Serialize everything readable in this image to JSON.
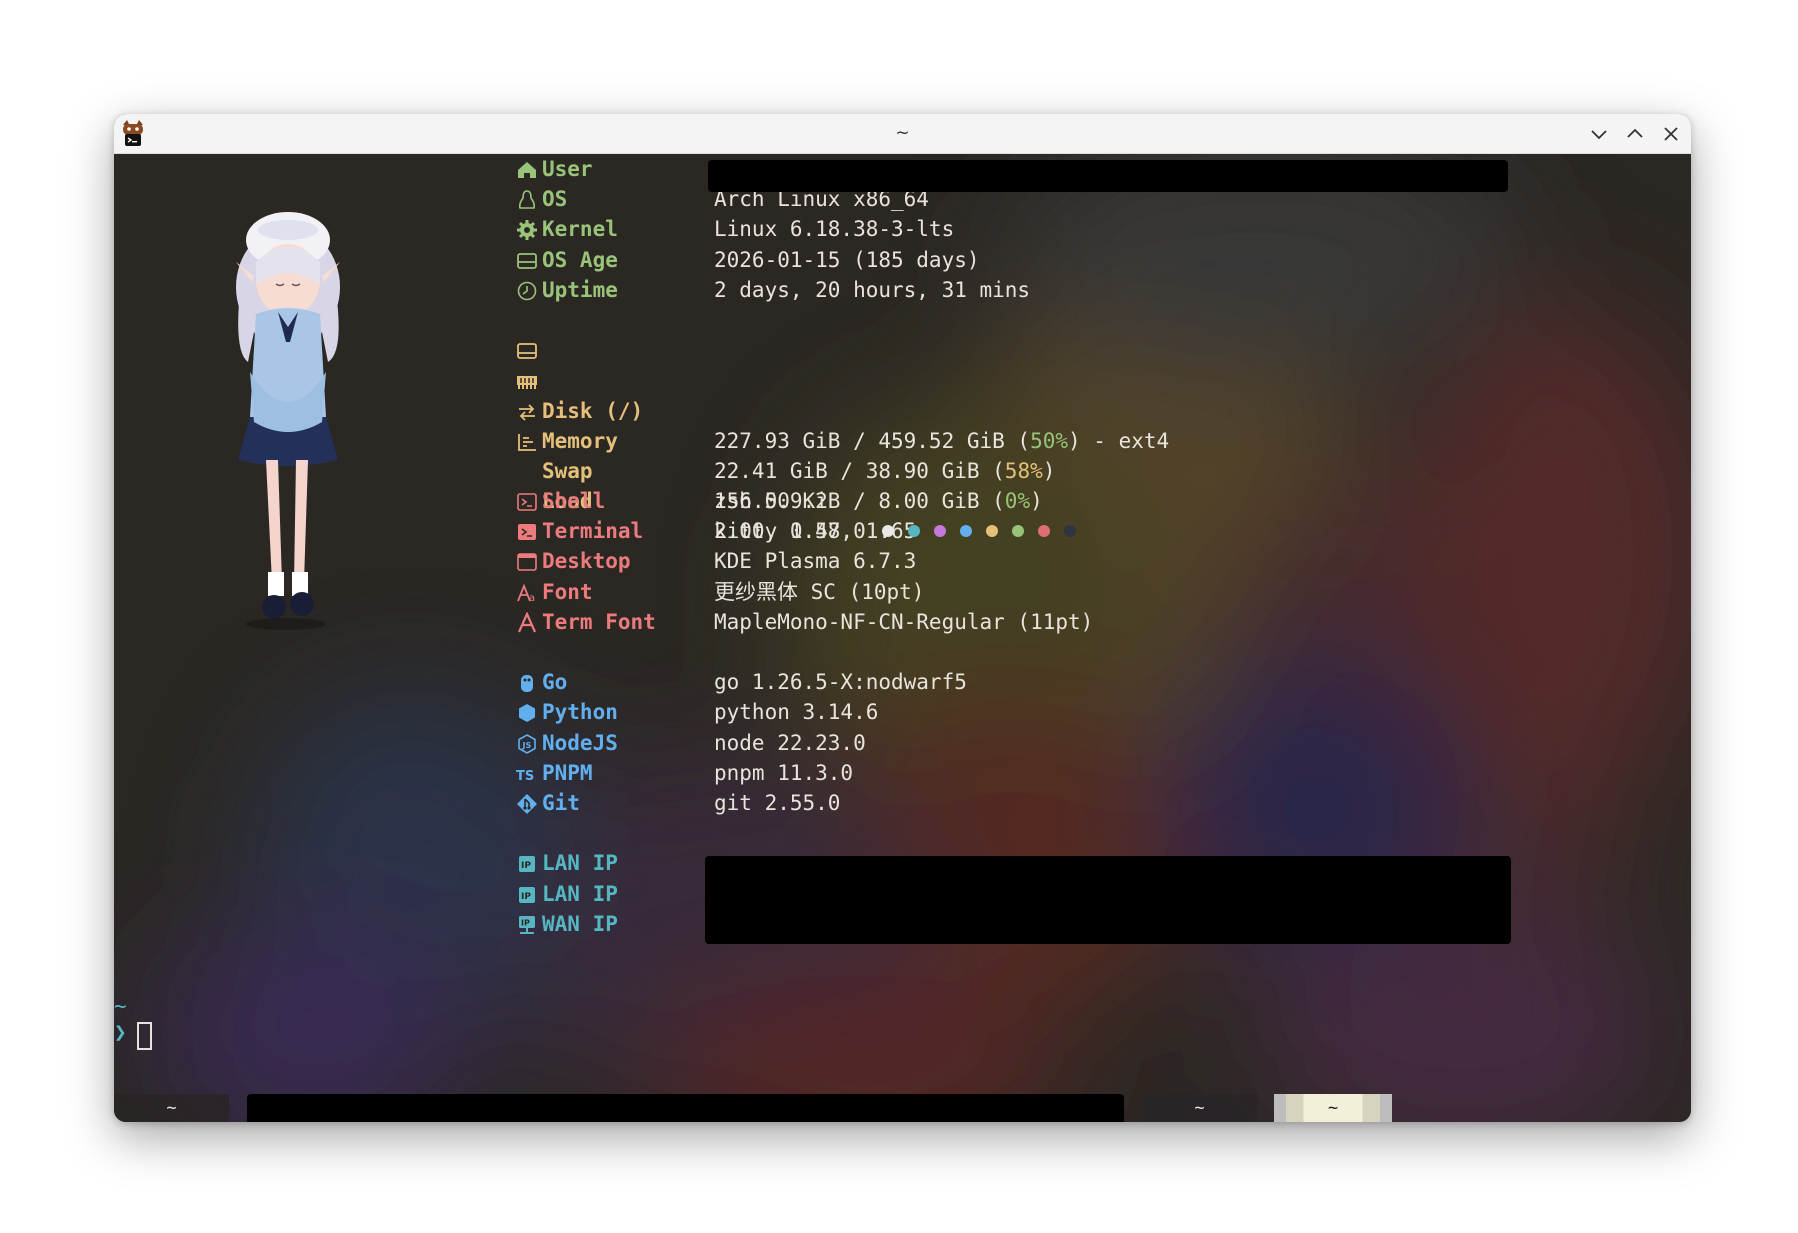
{
  "window": {
    "title": "~"
  },
  "info": {
    "system": [
      {
        "key": "User",
        "value": "",
        "icon": "house-icon"
      },
      {
        "key": "OS",
        "value": "Arch Linux x86_64",
        "icon": "linux-tux-icon"
      },
      {
        "key": "Kernel",
        "value": "Linux 6.18.38-3-lts",
        "icon": "gear-icon"
      },
      {
        "key": "OS Age",
        "value": "2026-01-15 (185 days)",
        "icon": "drive-icon"
      },
      {
        "key": "Uptime",
        "value": "2 days, 20 hours, 31 mins",
        "icon": "clock-icon"
      }
    ],
    "resources": {
      "disk": {
        "key": "Disk (/)",
        "pre": "227.93 GiB / 459.52 GiB (",
        "pct": "50%",
        "post": ") - ext4"
      },
      "memory": {
        "key": "Memory",
        "pre": "22.41 GiB / 38.90 GiB (",
        "pct": "58%",
        "post": ")"
      },
      "swap": {
        "key": "Swap",
        "pre": "156.00 KiB / 8.00 GiB (",
        "pct": "0%",
        "post": ")"
      },
      "load": {
        "key": "Load",
        "value": "2.00, 1.57, 1.65"
      }
    },
    "environment": [
      {
        "key": "Shell",
        "value": "zsh 5.9.2",
        "icon": "terminal-box-icon"
      },
      {
        "key": "Terminal",
        "value": "kitty 0.48.0",
        "icon": "terminal-filled-icon"
      },
      {
        "key": "Desktop",
        "value": "KDE Plasma 6.7.3",
        "icon": "window-icon"
      },
      {
        "key": "Font",
        "value": "更纱黑体 SC (10pt)",
        "icon": "font-aa-icon"
      },
      {
        "key": "Term Font",
        "value": "MapleMono-NF-CN-Regular (11pt)",
        "icon": "font-a-icon"
      }
    ],
    "palette": [
      "#e8e8e8",
      "#56b6c2",
      "#c678dd",
      "#61afef",
      "#e5c07b",
      "#98c379",
      "#e06c75",
      "#2e3440"
    ],
    "languages": [
      {
        "key": "Go",
        "value": "go 1.26.5-X:nodwarf5",
        "icon": "gopher-icon"
      },
      {
        "key": "Python",
        "value": "python 3.14.6",
        "icon": "python-hex-icon"
      },
      {
        "key": "NodeJS",
        "value": "node 22.23.0",
        "icon": "nodejs-icon"
      },
      {
        "key": "PNPM",
        "value": "pnpm 11.3.0",
        "icon": "ts-icon"
      },
      {
        "key": "Git",
        "value": "git 2.55.0",
        "icon": "git-icon"
      }
    ],
    "network": [
      {
        "key": "LAN IP",
        "icon": "ip-badge-icon"
      },
      {
        "key": "LAN IP",
        "icon": "ip-badge-icon"
      },
      {
        "key": "WAN IP",
        "icon": "network-icon"
      }
    ]
  },
  "prompt": {
    "cwd": "~",
    "symbol": "❯"
  },
  "tabs": [
    {
      "label": "~"
    },
    {
      "label": "~"
    },
    {
      "label": "~"
    }
  ]
}
